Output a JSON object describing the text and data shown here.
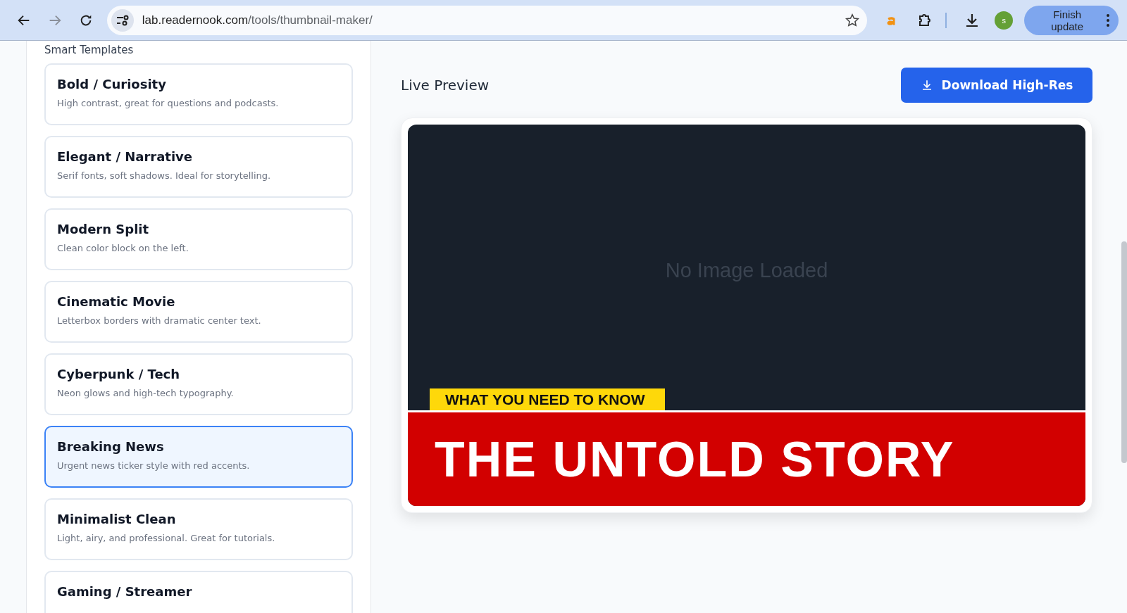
{
  "browser": {
    "url_host": "lab.readernook.com",
    "url_path": "/tools/thumbnail-maker/",
    "profile_initial": "s",
    "update_button": "Finish update"
  },
  "sidebar": {
    "title": "Smart Templates",
    "templates": [
      {
        "name": "Bold / Curiosity",
        "description": "High contrast, great for questions and podcasts.",
        "selected": false
      },
      {
        "name": "Elegant / Narrative",
        "description": "Serif fonts, soft shadows. Ideal for storytelling.",
        "selected": false
      },
      {
        "name": "Modern Split",
        "description": "Clean color block on the left.",
        "selected": false
      },
      {
        "name": "Cinematic Movie",
        "description": "Letterbox borders with dramatic center text.",
        "selected": false
      },
      {
        "name": "Cyberpunk / Tech",
        "description": "Neon glows and high-tech typography.",
        "selected": false
      },
      {
        "name": "Breaking News",
        "description": "Urgent news ticker style with red accents.",
        "selected": true
      },
      {
        "name": "Minimalist Clean",
        "description": "Light, airy, and professional. Great for tutorials.",
        "selected": false
      },
      {
        "name": "Gaming / Streamer",
        "selected": false
      }
    ]
  },
  "preview": {
    "title": "Live Preview",
    "download_button": "Download High-Res",
    "placeholder": "No Image Loaded",
    "tag": "WHAT YOU NEED TO KNOW",
    "headline": "THE UNTOLD STORY"
  }
}
